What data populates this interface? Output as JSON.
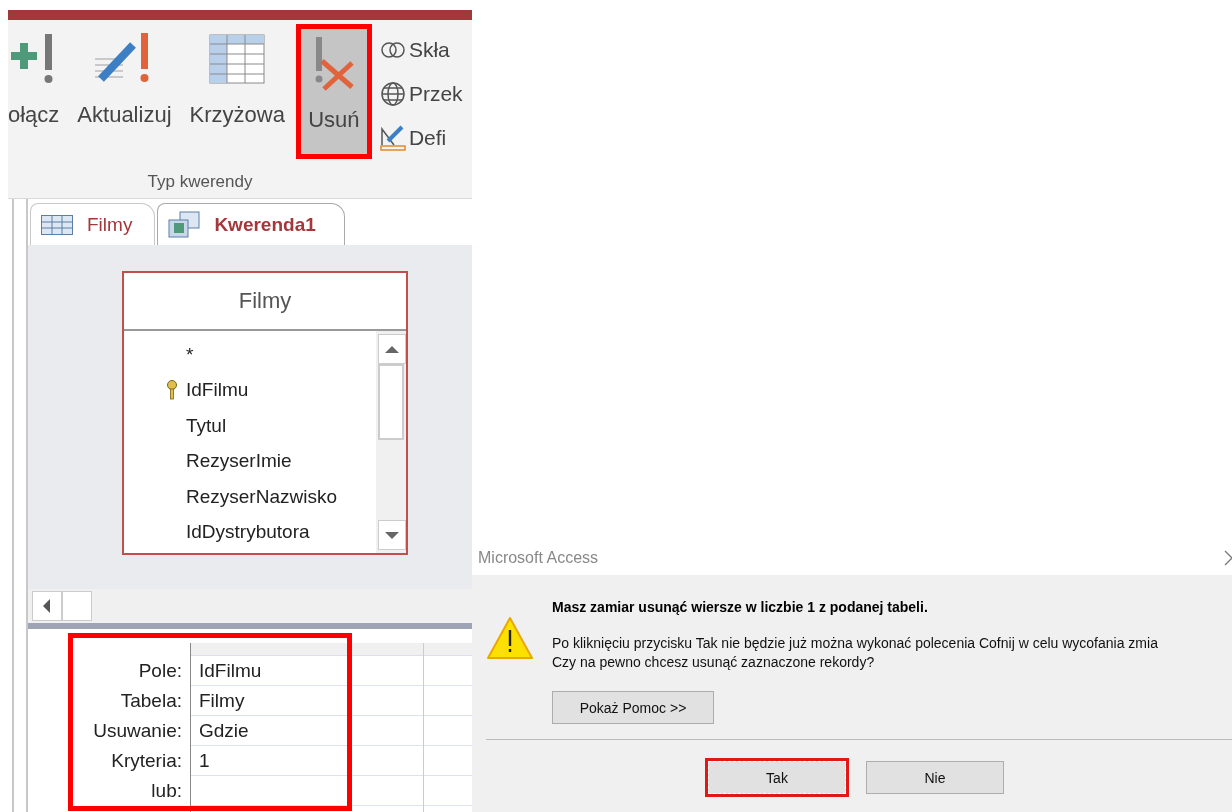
{
  "ribbon": {
    "buttons": [
      {
        "label": "ołącz",
        "kind": "append",
        "selected": false
      },
      {
        "label": "Aktualizuj",
        "kind": "update",
        "selected": false
      },
      {
        "label": "Krzyżowa",
        "kind": "crosstab",
        "selected": false
      },
      {
        "label": "Usuń",
        "kind": "delete",
        "selected": true
      }
    ],
    "small_buttons": [
      {
        "label": "Skła",
        "kind": "union"
      },
      {
        "label": "Przek",
        "kind": "passthrough"
      },
      {
        "label": "Defi",
        "kind": "define"
      }
    ],
    "group_label": "Typ kwerendy"
  },
  "tabs": [
    {
      "label": "Filmy",
      "kind": "table",
      "selected": false
    },
    {
      "label": "Kwerenda1",
      "kind": "query",
      "selected": true
    }
  ],
  "table_box": {
    "title": "Filmy",
    "fields": [
      {
        "name": "*",
        "primary_key": false
      },
      {
        "name": "IdFilmu",
        "primary_key": true
      },
      {
        "name": "Tytul",
        "primary_key": false
      },
      {
        "name": "RezyserImie",
        "primary_key": false
      },
      {
        "name": "RezyserNazwisko",
        "primary_key": false
      },
      {
        "name": "IdDystrybutora",
        "primary_key": false
      }
    ]
  },
  "grid": {
    "rows": [
      {
        "label": "Pole:",
        "value": "IdFilmu"
      },
      {
        "label": "Tabela:",
        "value": "Filmy"
      },
      {
        "label": "Usuwanie:",
        "value": "Gdzie"
      },
      {
        "label": "Kryteria:",
        "value": "1"
      },
      {
        "label": "lub:"
      }
    ]
  },
  "dialog": {
    "title": "Microsoft Access",
    "heading": "Masz zamiar usunąć wiersze w liczbie 1 z podanej tabeli.",
    "message": [
      "Po kliknięciu przycisku Tak nie będzie już można wykonać polecenia Cofnij w celu wycofania zmia",
      "Czy na pewno chcesz usunąć zaznaczone rekordy?"
    ],
    "help_button": "Pokaż Pomoc >>",
    "buttons": [
      {
        "label": "Tak",
        "selected": true
      },
      {
        "label": "Nie",
        "selected": false
      }
    ]
  }
}
